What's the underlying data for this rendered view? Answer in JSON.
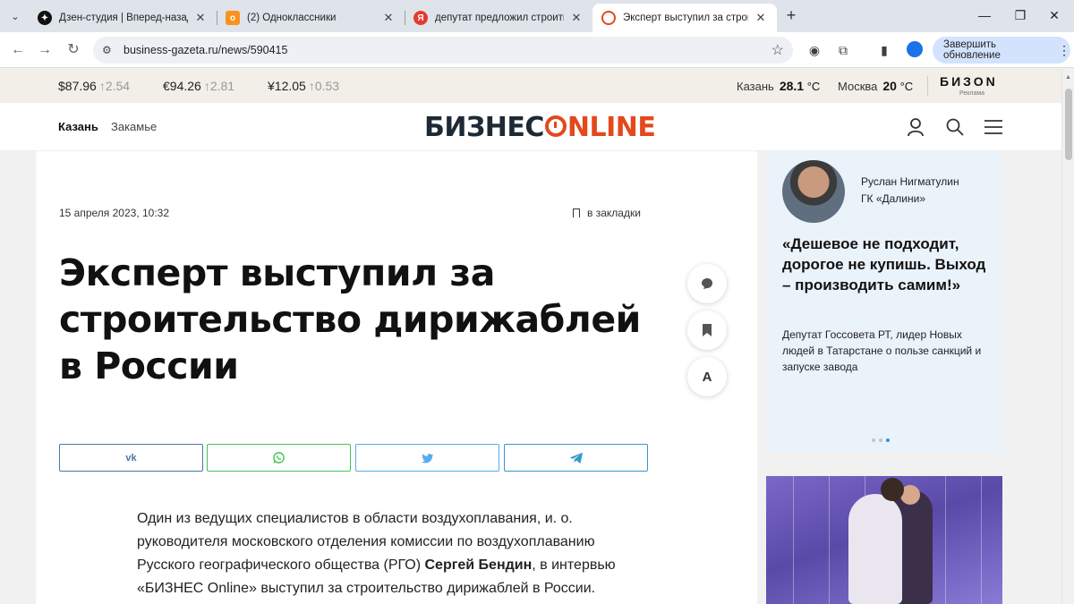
{
  "browser": {
    "tabs": [
      {
        "title": "Дзен-студия | Вперед-назад к",
        "icon": "dzen-icon",
        "color": "#111111"
      },
      {
        "title": "(2) Одноклассники",
        "icon": "ok-icon",
        "color": "#f7931e"
      },
      {
        "title": "депутат предложил строить д",
        "icon": "yandex-icon",
        "color": "#e43a2f"
      },
      {
        "title": "Эксперт выступил за строител",
        "icon": "bo-icon",
        "color": "#e4481c"
      }
    ],
    "url": "business-gazeta.ru/news/590415",
    "update_label": "Завершить обновление"
  },
  "ticker": {
    "usd": "$87.96",
    "usd_chg": "↑2.54",
    "eur": "€94.26",
    "eur_chg": "↑2.81",
    "cny": "¥12.05",
    "cny_chg": "↑0.53",
    "city1": "Казань",
    "temp1": "28.1",
    "city2": "Москва",
    "temp2": "20",
    "unit": "°C",
    "partner": "БИЗОN",
    "partner_sub": "Реклама"
  },
  "header": {
    "nav": [
      "Казань",
      "Закамье"
    ],
    "logo_left": "БИЗНЕС",
    "logo_right": "NLINE"
  },
  "article": {
    "date": "15 апреля 2023, 10:32",
    "bookmark_label": "в закладки",
    "headline": "Эксперт выступил за строительство дирижаблей в России",
    "font_button": "A",
    "body_1": "Один из ведущих специалистов в области воздухоплавания, и. о. руководителя московского отделения комиссии по воздухоплаванию Русского географического общества (РГО) ",
    "body_bold": "Сергей Бендин",
    "body_2": ", в интервью «БИЗНЕС Online» выступил за строительство дирижаблей в России."
  },
  "share": [
    {
      "name": "vk",
      "color": "#4a76a8"
    },
    {
      "name": "whatsapp",
      "color": "#43c553"
    },
    {
      "name": "twitter",
      "color": "#55acee"
    },
    {
      "name": "telegram",
      "color": "#3399cc"
    }
  ],
  "quote": {
    "name": "Руслан Нигматулин",
    "org": "ГК «Далини»",
    "text": "«Дешевое не подходит, дорогое не купишь. Выход – производить самим!»",
    "desc": "Депутат Госсовета РТ, лидер Новых людей в Татарстане о пользе санкций и запуске завода"
  },
  "colors": {
    "accent": "#e4481c",
    "logo_dark": "#1d2a36"
  }
}
